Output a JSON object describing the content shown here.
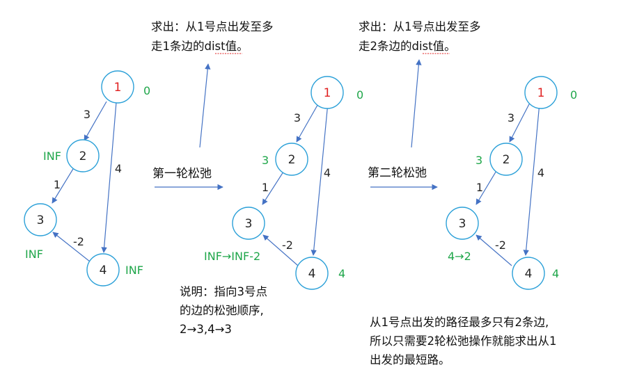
{
  "colors": {
    "node_border": "#2ba0d8",
    "edge": "#4472c4",
    "source_label": "#e02020",
    "dist_text": "#1fa64a",
    "text": "#262626"
  },
  "graphs": [
    {
      "nodes": [
        {
          "label": "1",
          "dist": "0"
        },
        {
          "label": "2",
          "dist": "INF"
        },
        {
          "label": "3",
          "dist": "INF"
        },
        {
          "label": "4",
          "dist": "INF"
        }
      ],
      "weights": [
        "3",
        "1",
        "4",
        "-2"
      ]
    },
    {
      "nodes": [
        {
          "label": "1",
          "dist": "0"
        },
        {
          "label": "2",
          "dist": "3"
        },
        {
          "label": "3",
          "dist": "INF→INF-2"
        },
        {
          "label": "4",
          "dist": "4"
        }
      ],
      "weights": [
        "3",
        "1",
        "4",
        "-2"
      ]
    },
    {
      "nodes": [
        {
          "label": "1",
          "dist": "0"
        },
        {
          "label": "2",
          "dist": "3"
        },
        {
          "label": "3",
          "dist": "4→2"
        },
        {
          "label": "4",
          "dist": "4"
        }
      ],
      "weights": [
        "3",
        "1",
        "4",
        "-2"
      ]
    }
  ],
  "rounds": [
    {
      "label": "第一轮松弛",
      "caption": [
        "求出：从1号点出发至多",
        "走1条边的dist值。"
      ]
    },
    {
      "label": "第二轮松弛",
      "caption": [
        "求出：从1号点出发至多",
        "走2条边的dist值。"
      ]
    }
  ],
  "note_order": [
    "说明：指向3号点",
    "的边的松弛顺序,",
    "2→3,4→3"
  ],
  "note_conclusion": [
    "从1号点出发的路径最多只有2条边,",
    "所以只需要2轮松弛操作就能求出从1",
    "出发的最短路。"
  ]
}
